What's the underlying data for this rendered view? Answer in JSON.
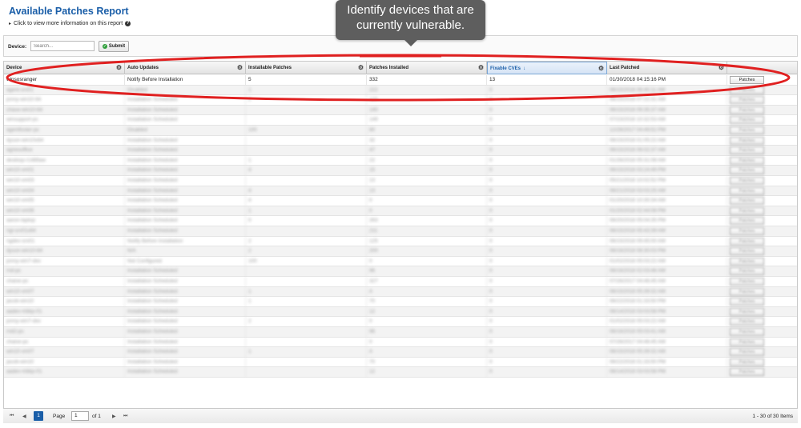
{
  "report": {
    "title": "Available Patches Report",
    "subtitle": "Click to view more information on this report"
  },
  "filter": {
    "device_label": "Device:",
    "device_placeholder": "Search...",
    "submit_label": "Submit"
  },
  "tooltip": {
    "line1": "Identify devices that are",
    "line2": "currently vulnerable."
  },
  "columns": [
    "Device",
    "Auto Updates",
    "Installable Patches",
    "Patches Installed",
    "Fixable CVEs",
    "Last Patched"
  ],
  "sorted_column": "Fixable CVEs",
  "patch_button_label": "Patches",
  "rows": [
    {
      "device": "winsosranger",
      "auto": "Notify Before Installation",
      "installable": "5",
      "installed": "332",
      "cves": "13",
      "last": "01/30/2018 04:15:16 PM",
      "blurred": false
    },
    {
      "device": "agent-srv01",
      "auto": "Disabled",
      "installable": "1",
      "installed": "222",
      "cves": "0",
      "last": "08/15/2018 06:40:11 AM",
      "blurred": true
    },
    {
      "device": "jonny-win10-64",
      "auto": "Installation Scheduled",
      "installable": "2",
      "installed": "120",
      "cves": "0",
      "last": "08/15/2018 07:22:31 AM",
      "blurred": true
    },
    {
      "device": "chase-win10-64",
      "auto": "Installation Scheduled",
      "installable": "",
      "installed": "140",
      "cves": "0",
      "last": "08/15/2018 09:35:37 AM",
      "blurred": true
    },
    {
      "device": "winsupport-pc",
      "auto": "Installation Scheduled",
      "installable": "",
      "installed": "149",
      "cves": "0",
      "last": "07/23/2018 10:32:53 AM",
      "blurred": true
    },
    {
      "device": "agentfoster-pc",
      "auto": "Disabled",
      "installable": "100",
      "installed": "80",
      "cves": "0",
      "last": "12/26/2017 04:49:52 PM",
      "blurred": true
    },
    {
      "device": "dyson-win10x64",
      "auto": "Installation Scheduled",
      "installable": "",
      "installed": "32",
      "cves": "0",
      "last": "08/15/2018 01:05:22 AM",
      "blurred": true
    },
    {
      "device": "agnesoffice",
      "auto": "Installation Scheduled",
      "installable": "",
      "installed": "47",
      "cves": "0",
      "last": "08/15/2018 06:02:37 AM",
      "blurred": true
    },
    {
      "device": "desktop-r1489aw",
      "auto": "Installation Scheduled",
      "installable": "1",
      "installed": "22",
      "cves": "0",
      "last": "01/26/2018 05:31:08 AM",
      "blurred": true
    },
    {
      "device": "win10-vm01",
      "auto": "Installation Scheduled",
      "installable": "4",
      "installed": "15",
      "cves": "0",
      "last": "08/15/2018 03:24:49 PM",
      "blurred": true
    },
    {
      "device": "win10-vm03",
      "auto": "Installation Scheduled",
      "installable": "",
      "installed": "13",
      "cves": "0",
      "last": "05/21/2018 10:02:52 PM",
      "blurred": true
    },
    {
      "device": "win10-vm04",
      "auto": "Installation Scheduled",
      "installable": "4",
      "installed": "13",
      "cves": "0",
      "last": "08/21/2018 03:03:25 AM",
      "blurred": true
    },
    {
      "device": "win10-vm05",
      "auto": "Installation Scheduled",
      "installable": "4",
      "installed": "0",
      "cves": "0",
      "last": "01/20/2018 10:30:34 AM",
      "blurred": true
    },
    {
      "device": "win10-vm06",
      "auto": "Installation Scheduled",
      "installable": "1",
      "installed": "0",
      "cves": "0",
      "last": "01/20/2018 02:44:08 PM",
      "blurred": true
    },
    {
      "device": "aaron-laptop",
      "auto": "Installation Scheduled",
      "installable": "0",
      "installed": "263",
      "cves": "0",
      "last": "08/20/2018 05:04:35 PM",
      "blurred": true
    },
    {
      "device": "ngi-srv01x64",
      "auto": "Installation Scheduled",
      "installable": "",
      "installed": "211",
      "cves": "0",
      "last": "08/15/2018 05:43:39 AM",
      "blurred": true
    },
    {
      "device": "ngdev-srv01",
      "auto": "Notify Before Installation",
      "installable": "2",
      "installed": "125",
      "cves": "0",
      "last": "08/15/2018 09:45:00 AM",
      "blurred": true
    },
    {
      "device": "dyson-win10-64",
      "auto": "N/A",
      "installable": "2",
      "installed": "200",
      "cves": "0",
      "last": "08/16/2018 08:30:03 PM",
      "blurred": true
    },
    {
      "device": "jonny-win7-dev",
      "auto": "Not Configured",
      "installable": "100",
      "installed": "0",
      "cves": "0",
      "last": "01/02/2018 05:03:22 AM",
      "blurred": true
    },
    {
      "device": "rnd-pc",
      "auto": "Installation Scheduled",
      "installable": "",
      "installed": "96",
      "cves": "0",
      "last": "08/16/2018 02:03:46 AM",
      "blurred": true
    },
    {
      "device": "chaise-pc",
      "auto": "Installation Scheduled",
      "installable": "",
      "installed": "327",
      "cves": "0",
      "last": "07/26/2017 04:46:45 AM",
      "blurred": true
    },
    {
      "device": "win10-vm07",
      "auto": "Installation Scheduled",
      "installable": "1",
      "installed": "4",
      "cves": "0",
      "last": "08/15/2018 05:39:32 AM",
      "blurred": true
    },
    {
      "device": "jacob-win10",
      "auto": "Installation Scheduled",
      "installable": "1",
      "installed": "70",
      "cves": "0",
      "last": "08/22/2018 01:33:50 PM",
      "blurred": true
    },
    {
      "device": "aadev-mbkp-01",
      "auto": "Installation Scheduled",
      "installable": "",
      "installed": "12",
      "cves": "0",
      "last": "08/14/2018 03:03:58 PM",
      "blurred": true
    },
    {
      "device": "jonny-win7-dev",
      "auto": "Installation Scheduled",
      "installable": "2",
      "installed": "0",
      "cves": "0",
      "last": "01/02/2018 05:03:22 AM",
      "blurred": true
    },
    {
      "device": "rnd2-pc",
      "auto": "Installation Scheduled",
      "installable": "",
      "installed": "96",
      "cves": "0",
      "last": "08/16/2018 05:03:41 AM",
      "blurred": true
    },
    {
      "device": "chaise-pc",
      "auto": "Installation Scheduled",
      "installable": "",
      "installed": "0",
      "cves": "0",
      "last": "07/26/2017 04:46:45 AM",
      "blurred": true
    },
    {
      "device": "win10-vm07",
      "auto": "Installation Scheduled",
      "installable": "1",
      "installed": "4",
      "cves": "0",
      "last": "08/15/2018 05:39:32 AM",
      "blurred": true
    },
    {
      "device": "jacob-win10",
      "auto": "Installation Scheduled",
      "installable": "",
      "installed": "70",
      "cves": "0",
      "last": "08/22/2018 01:33:50 PM",
      "blurred": true
    },
    {
      "device": "aadev-mbkp-01",
      "auto": "Installation Scheduled",
      "installable": "",
      "installed": "12",
      "cves": "0",
      "last": "08/14/2018 03:03:58 PM",
      "blurred": true
    }
  ],
  "pager": {
    "page_label": "Page",
    "page_value": "1",
    "of_label": "of 1",
    "current_page": "1",
    "summary": "1 - 30 of 30 Items"
  },
  "annotation_color": "#e02020",
  "tooltip_color": "#5e5e5e",
  "accent_color": "#1a5ea8"
}
